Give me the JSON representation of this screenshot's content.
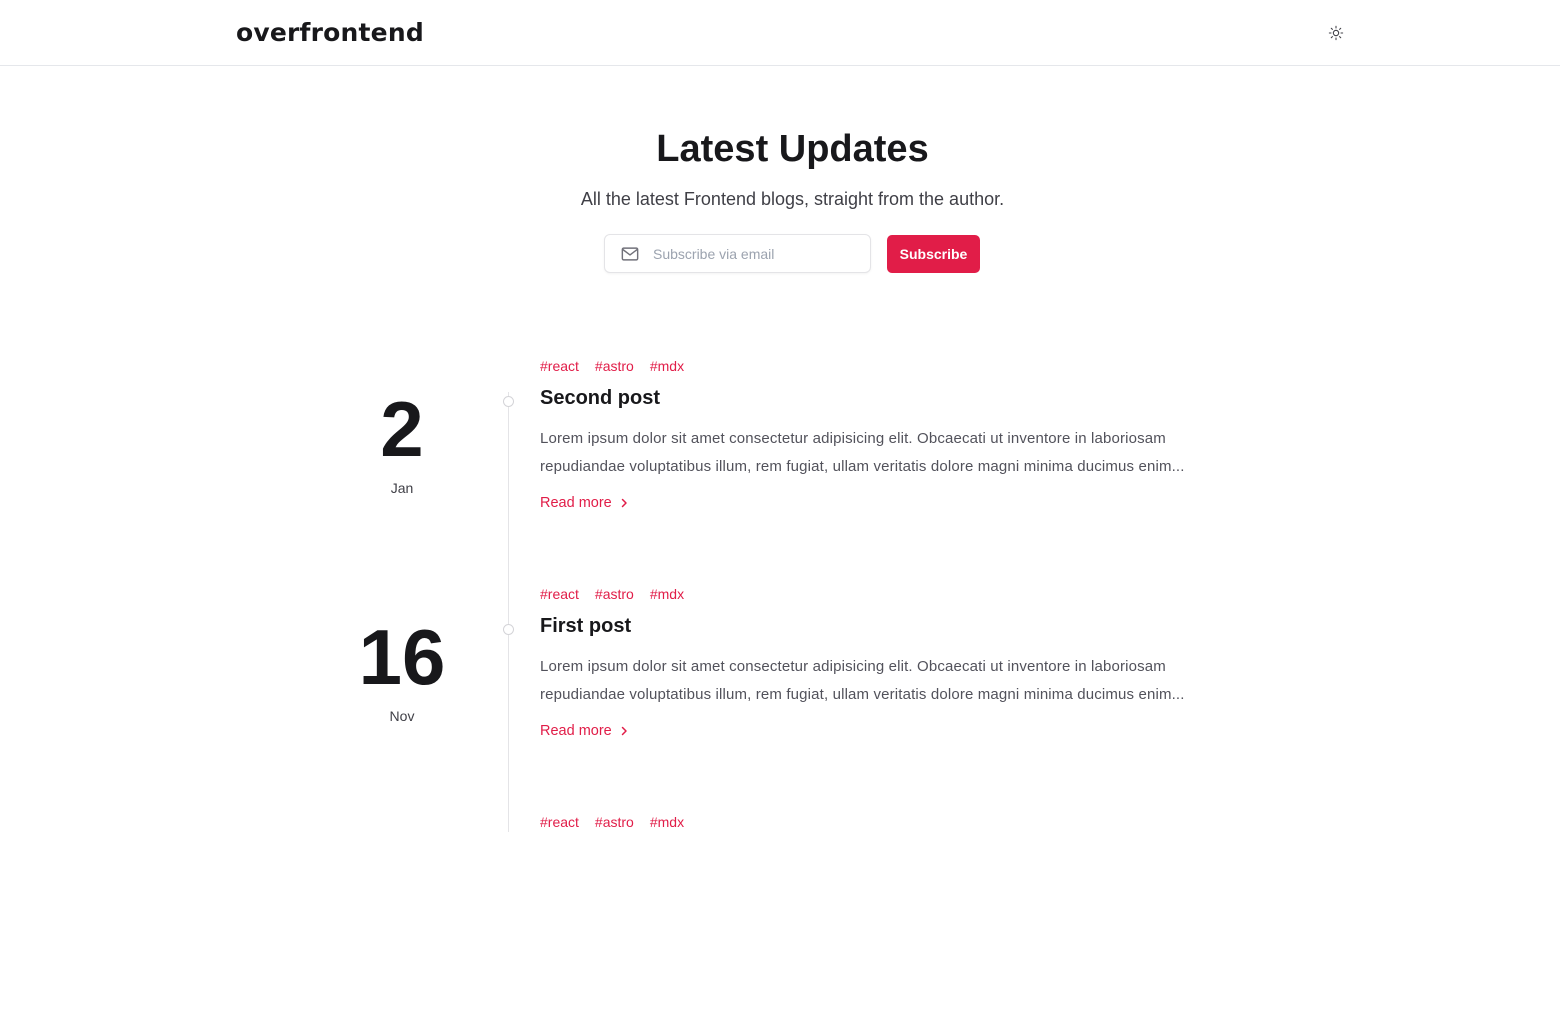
{
  "header": {
    "logo": "overfrontend",
    "theme_toggle_icon": "sun-icon"
  },
  "hero": {
    "title": "Latest Updates",
    "subtitle": "All the latest Frontend blogs, straight from the author.",
    "email_placeholder": "Subscribe via email",
    "email_value": "",
    "email_icon": "mail-icon",
    "subscribe_label": "Subscribe"
  },
  "colors": {
    "accent": "#e11d48",
    "text": "#18181b",
    "muted": "#52525b",
    "border": "#e4e4e7"
  },
  "posts": [
    {
      "day": "2",
      "month": "Jan",
      "tags": [
        "#react",
        "#astro",
        "#mdx"
      ],
      "title": "Second post",
      "excerpt_line1": "Lorem ipsum dolor sit amet consectetur adipisicing elit. Obcaecati ut inventore in laboriosam",
      "excerpt_line2": "repudiandae voluptatibus illum, rem fugiat, ullam veritatis dolore magni minima ducimus enim...",
      "read_more": "Read more"
    },
    {
      "day": "16",
      "month": "Nov",
      "tags": [
        "#react",
        "#astro",
        "#mdx"
      ],
      "title": "First post",
      "excerpt_line1": "Lorem ipsum dolor sit amet consectetur adipisicing elit. Obcaecati ut inventore in laboriosam",
      "excerpt_line2": "repudiandae voluptatibus illum, rem fugiat, ullam veritatis dolore magni minima ducimus enim...",
      "read_more": "Read more"
    },
    {
      "tags": [
        "#react",
        "#astro",
        "#mdx"
      ]
    }
  ]
}
